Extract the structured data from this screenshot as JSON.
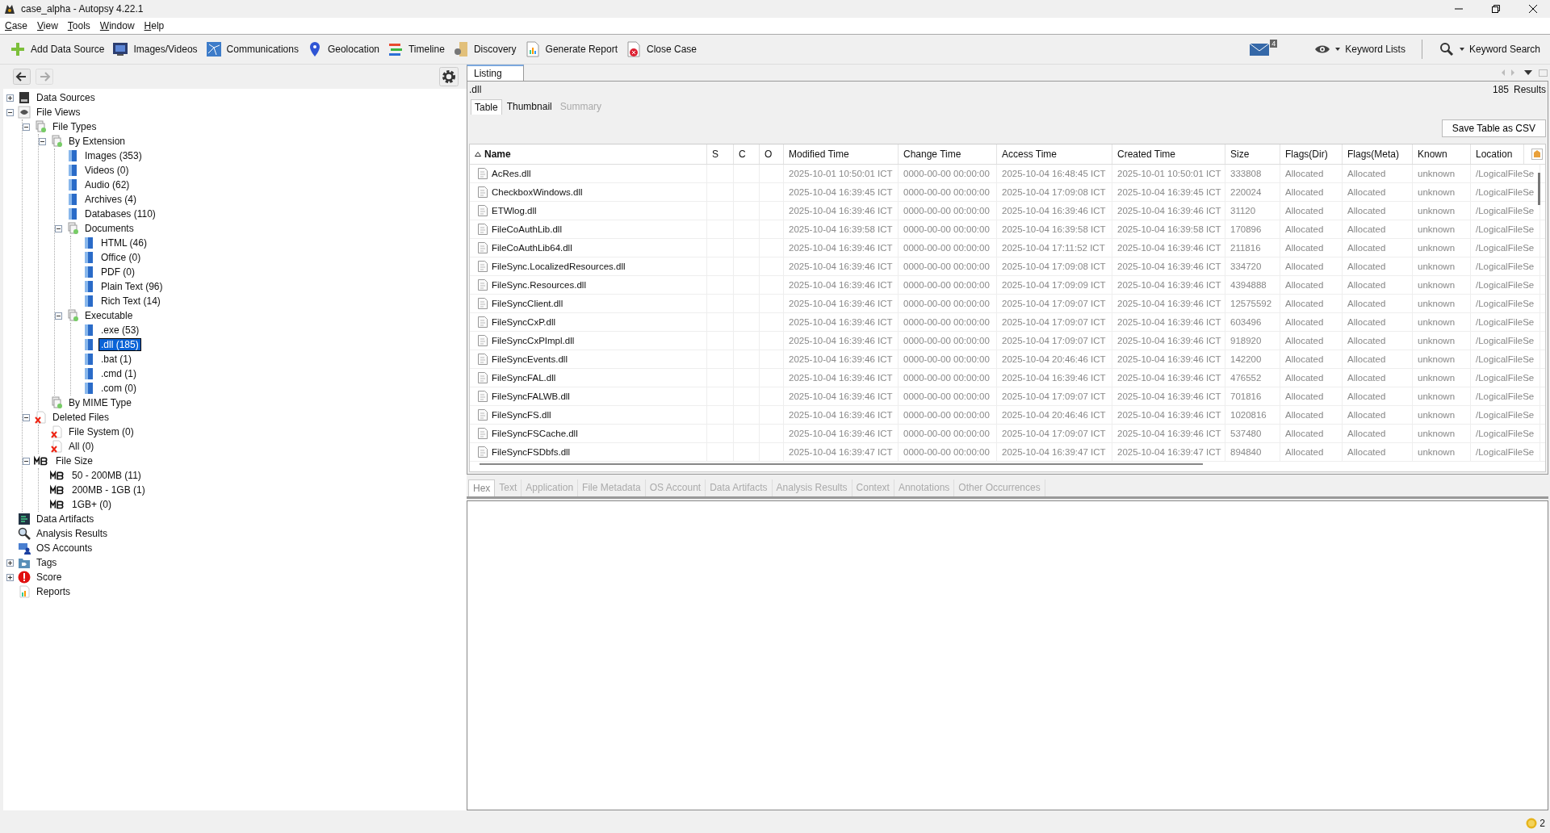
{
  "window": {
    "title": "case_alpha - Autopsy 4.22.1"
  },
  "menu": [
    "Case",
    "View",
    "Tools",
    "Window",
    "Help"
  ],
  "toolbar": [
    {
      "label": "Add Data Source",
      "kind": "add"
    },
    {
      "label": "Images/Videos",
      "kind": "images"
    },
    {
      "label": "Communications",
      "kind": "comms"
    },
    {
      "label": "Geolocation",
      "kind": "geo"
    },
    {
      "label": "Timeline",
      "kind": "timeline"
    },
    {
      "label": "Discovery",
      "kind": "discovery"
    },
    {
      "label": "Generate Report",
      "kind": "report"
    },
    {
      "label": "Close Case",
      "kind": "close"
    }
  ],
  "notifications": {
    "badge": "4"
  },
  "right_tools": [
    {
      "label": "Keyword Lists",
      "kind": "eye"
    },
    {
      "label": "Keyword Search",
      "kind": "search"
    }
  ],
  "tree": [
    {
      "label": "Data Sources",
      "kind": "disk",
      "expanded": false,
      "selected": false
    },
    {
      "label": "File Views",
      "kind": "eye",
      "expanded": true,
      "selected": false,
      "children": [
        {
          "label": "File Types",
          "kind": "group",
          "expanded": true,
          "selected": false,
          "children": [
            {
              "label": "By Extension",
              "kind": "group",
              "expanded": true,
              "selected": false,
              "children": [
                {
                  "label": "Images (353)",
                  "kind": "folder",
                  "selected": false
                },
                {
                  "label": "Videos (0)",
                  "kind": "folder",
                  "selected": false
                },
                {
                  "label": "Audio (62)",
                  "kind": "folder",
                  "selected": false
                },
                {
                  "label": "Archives (4)",
                  "kind": "folder",
                  "selected": false
                },
                {
                  "label": "Databases (110)",
                  "kind": "folder",
                  "selected": false
                },
                {
                  "label": "Documents",
                  "kind": "group",
                  "expanded": true,
                  "selected": false,
                  "children": [
                    {
                      "label": "HTML (46)",
                      "kind": "folder",
                      "selected": false
                    },
                    {
                      "label": "Office (0)",
                      "kind": "folder",
                      "selected": false
                    },
                    {
                      "label": "PDF (0)",
                      "kind": "folder",
                      "selected": false
                    },
                    {
                      "label": "Plain Text (96)",
                      "kind": "folder",
                      "selected": false
                    },
                    {
                      "label": "Rich Text (14)",
                      "kind": "folder",
                      "selected": false
                    }
                  ]
                },
                {
                  "label": "Executable",
                  "kind": "group",
                  "expanded": true,
                  "selected": false,
                  "children": [
                    {
                      "label": ".exe (53)",
                      "kind": "folder",
                      "selected": false
                    },
                    {
                      "label": ".dll (185)",
                      "kind": "folder",
                      "selected": true
                    },
                    {
                      "label": ".bat (1)",
                      "kind": "folder",
                      "selected": false
                    },
                    {
                      "label": ".cmd (1)",
                      "kind": "folder",
                      "selected": false
                    },
                    {
                      "label": ".com (0)",
                      "kind": "folder",
                      "selected": false
                    }
                  ]
                }
              ]
            },
            {
              "label": "By MIME Type",
              "kind": "group",
              "selected": false
            }
          ]
        },
        {
          "label": "Deleted Files",
          "kind": "deleted",
          "expanded": true,
          "selected": false,
          "children": [
            {
              "label": "File System (0)",
              "kind": "deleted",
              "selected": false
            },
            {
              "label": "All (0)",
              "kind": "deleted",
              "selected": false
            }
          ]
        },
        {
          "label": "File Size",
          "kind": "mb",
          "expanded": true,
          "selected": false,
          "children": [
            {
              "label": "50 - 200MB (11)",
              "kind": "mb",
              "selected": false
            },
            {
              "label": "200MB - 1GB (1)",
              "kind": "mb",
              "selected": false
            },
            {
              "label": "1GB+ (0)",
              "kind": "mb",
              "selected": false
            }
          ]
        }
      ]
    },
    {
      "label": "Data Artifacts",
      "kind": "artifacts",
      "selected": false
    },
    {
      "label": "Analysis Results",
      "kind": "analysis",
      "selected": false
    },
    {
      "label": "OS Accounts",
      "kind": "accounts",
      "selected": false
    },
    {
      "label": "Tags",
      "kind": "tags",
      "expanded": false,
      "selected": false
    },
    {
      "label": "Score",
      "kind": "score",
      "expanded": false,
      "selected": false
    },
    {
      "label": "Reports",
      "kind": "reports",
      "selected": false
    }
  ],
  "listing": {
    "tab": "Listing",
    "path": ".dll",
    "results_count": "185",
    "results_label": "Results",
    "view_tabs": [
      {
        "label": "Table",
        "selected": true,
        "disabled": false
      },
      {
        "label": "Thumbnail",
        "selected": false,
        "disabled": false
      },
      {
        "label": "Summary",
        "selected": false,
        "disabled": true
      }
    ],
    "save_button": "Save Table as CSV",
    "table": {
      "columns": [
        "Name",
        "S",
        "C",
        "O",
        "Modified Time",
        "Change Time",
        "Access Time",
        "Created Time",
        "Size",
        "Flags(Dir)",
        "Flags(Meta)",
        "Known",
        "Location"
      ],
      "rows": [
        [
          "AcRes.dll",
          "",
          "",
          "",
          "2025-10-01 10:50:01 ICT",
          "0000-00-00 00:00:00",
          "2025-10-04 16:48:45 ICT",
          "2025-10-01 10:50:01 ICT",
          "333808",
          "Allocated",
          "Allocated",
          "unknown",
          "/LogicalFileSe"
        ],
        [
          "CheckboxWindows.dll",
          "",
          "",
          "",
          "2025-10-04 16:39:45 ICT",
          "0000-00-00 00:00:00",
          "2025-10-04 17:09:08 ICT",
          "2025-10-04 16:39:45 ICT",
          "220024",
          "Allocated",
          "Allocated",
          "unknown",
          "/LogicalFileSe"
        ],
        [
          "ETWlog.dll",
          "",
          "",
          "",
          "2025-10-04 16:39:46 ICT",
          "0000-00-00 00:00:00",
          "2025-10-04 16:39:46 ICT",
          "2025-10-04 16:39:46 ICT",
          "31120",
          "Allocated",
          "Allocated",
          "unknown",
          "/LogicalFileSe"
        ],
        [
          "FileCoAuthLib.dll",
          "",
          "",
          "",
          "2025-10-04 16:39:58 ICT",
          "0000-00-00 00:00:00",
          "2025-10-04 16:39:58 ICT",
          "2025-10-04 16:39:58 ICT",
          "170896",
          "Allocated",
          "Allocated",
          "unknown",
          "/LogicalFileSe"
        ],
        [
          "FileCoAuthLib64.dll",
          "",
          "",
          "",
          "2025-10-04 16:39:46 ICT",
          "0000-00-00 00:00:00",
          "2025-10-04 17:11:52 ICT",
          "2025-10-04 16:39:46 ICT",
          "211816",
          "Allocated",
          "Allocated",
          "unknown",
          "/LogicalFileSe"
        ],
        [
          "FileSync.LocalizedResources.dll",
          "",
          "",
          "",
          "2025-10-04 16:39:46 ICT",
          "0000-00-00 00:00:00",
          "2025-10-04 17:09:08 ICT",
          "2025-10-04 16:39:46 ICT",
          "334720",
          "Allocated",
          "Allocated",
          "unknown",
          "/LogicalFileSe"
        ],
        [
          "FileSync.Resources.dll",
          "",
          "",
          "",
          "2025-10-04 16:39:46 ICT",
          "0000-00-00 00:00:00",
          "2025-10-04 17:09:09 ICT",
          "2025-10-04 16:39:46 ICT",
          "4394888",
          "Allocated",
          "Allocated",
          "unknown",
          "/LogicalFileSe"
        ],
        [
          "FileSyncClient.dll",
          "",
          "",
          "",
          "2025-10-04 16:39:46 ICT",
          "0000-00-00 00:00:00",
          "2025-10-04 17:09:07 ICT",
          "2025-10-04 16:39:46 ICT",
          "12575592",
          "Allocated",
          "Allocated",
          "unknown",
          "/LogicalFileSe"
        ],
        [
          "FileSyncCxP.dll",
          "",
          "",
          "",
          "2025-10-04 16:39:46 ICT",
          "0000-00-00 00:00:00",
          "2025-10-04 17:09:07 ICT",
          "2025-10-04 16:39:46 ICT",
          "603496",
          "Allocated",
          "Allocated",
          "unknown",
          "/LogicalFileSe"
        ],
        [
          "FileSyncCxPImpl.dll",
          "",
          "",
          "",
          "2025-10-04 16:39:46 ICT",
          "0000-00-00 00:00:00",
          "2025-10-04 17:09:07 ICT",
          "2025-10-04 16:39:46 ICT",
          "918920",
          "Allocated",
          "Allocated",
          "unknown",
          "/LogicalFileSe"
        ],
        [
          "FileSyncEvents.dll",
          "",
          "",
          "",
          "2025-10-04 16:39:46 ICT",
          "0000-00-00 00:00:00",
          "2025-10-04 20:46:46 ICT",
          "2025-10-04 16:39:46 ICT",
          "142200",
          "Allocated",
          "Allocated",
          "unknown",
          "/LogicalFileSe"
        ],
        [
          "FileSyncFAL.dll",
          "",
          "",
          "",
          "2025-10-04 16:39:46 ICT",
          "0000-00-00 00:00:00",
          "2025-10-04 16:39:46 ICT",
          "2025-10-04 16:39:46 ICT",
          "476552",
          "Allocated",
          "Allocated",
          "unknown",
          "/LogicalFileSe"
        ],
        [
          "FileSyncFALWB.dll",
          "",
          "",
          "",
          "2025-10-04 16:39:46 ICT",
          "0000-00-00 00:00:00",
          "2025-10-04 17:09:07 ICT",
          "2025-10-04 16:39:46 ICT",
          "701816",
          "Allocated",
          "Allocated",
          "unknown",
          "/LogicalFileSe"
        ],
        [
          "FileSyncFS.dll",
          "",
          "",
          "",
          "2025-10-04 16:39:46 ICT",
          "0000-00-00 00:00:00",
          "2025-10-04 20:46:46 ICT",
          "2025-10-04 16:39:46 ICT",
          "1020816",
          "Allocated",
          "Allocated",
          "unknown",
          "/LogicalFileSe"
        ],
        [
          "FileSyncFSCache.dll",
          "",
          "",
          "",
          "2025-10-04 16:39:46 ICT",
          "0000-00-00 00:00:00",
          "2025-10-04 17:09:07 ICT",
          "2025-10-04 16:39:46 ICT",
          "537480",
          "Allocated",
          "Allocated",
          "unknown",
          "/LogicalFileSe"
        ],
        [
          "FileSyncFSDbfs.dll",
          "",
          "",
          "",
          "2025-10-04 16:39:47 ICT",
          "0000-00-00 00:00:00",
          "2025-10-04 16:39:47 ICT",
          "2025-10-04 16:39:47 ICT",
          "894840",
          "Allocated",
          "Allocated",
          "unknown",
          "/LogicalFileSe"
        ]
      ]
    }
  },
  "content_tabs": [
    {
      "label": "Hex",
      "selected": true
    },
    {
      "label": "Text",
      "selected": false
    },
    {
      "label": "Application",
      "selected": false
    },
    {
      "label": "File Metadata",
      "selected": false
    },
    {
      "label": "OS Account",
      "selected": false
    },
    {
      "label": "Data Artifacts",
      "selected": false
    },
    {
      "label": "Analysis Results",
      "selected": false
    },
    {
      "label": "Context",
      "selected": false
    },
    {
      "label": "Annotations",
      "selected": false
    },
    {
      "label": "Other Occurrences",
      "selected": false
    }
  ],
  "status_bar": {
    "count": "2"
  }
}
